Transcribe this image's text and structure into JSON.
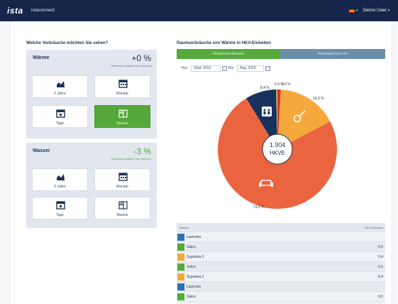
{
  "topbar": {
    "logo": "ista",
    "app_name": "istaconnect",
    "user": "Demo User",
    "user_caret": "▾",
    "language_caret": "▾"
  },
  "left": {
    "heading": "Welche Verbräuche möchten Sie sehen?",
    "warm": {
      "title": "Wärme",
      "value": "+0 %",
      "subtitle": "Verbrauchs-Vergleich zum Vormonat",
      "tiles": [
        {
          "label": "3 Jahre",
          "icon": "chart-icon"
        },
        {
          "label": "Monate",
          "icon": "calendar-month-icon"
        },
        {
          "label": "Tage",
          "icon": "calendar-day-icon"
        },
        {
          "label": "Räume",
          "icon": "rooms-icon",
          "active": true
        }
      ]
    },
    "water": {
      "title": "Wasser",
      "value": "-3 %",
      "subtitle": "Verbrauchs-Vergleich zum Vormonat",
      "tiles": [
        {
          "label": "3 Jahre",
          "icon": "chart-icon"
        },
        {
          "label": "Monate",
          "icon": "calendar-month-icon"
        },
        {
          "label": "Tage",
          "icon": "calendar-day-icon"
        },
        {
          "label": "Räume",
          "icon": "rooms-icon"
        }
      ]
    }
  },
  "right": {
    "heading": "Raumverbräuche von Wärme in HKV-Einheiten",
    "tabs": [
      "Gesamtverbrauch",
      "Verbrauch pro m²"
    ],
    "filter": {
      "from_label": "Von:",
      "from_value": "Sept. 2014",
      "to_label": "Bis:",
      "to_value": "Aug. 2016"
    },
    "center": {
      "value": "1.904",
      "unit": "HKVE"
    },
    "pie_labels": [
      "8,4 %",
      "0,3 %",
      "0,9 %",
      "16,3 %",
      "73,5 %"
    ],
    "table": {
      "headers": [
        "Räume",
        "HKV-Einheiten"
      ],
      "rows": [
        {
          "name": "Łazienka",
          "value": "",
          "color": "#2f6fb8"
        },
        {
          "name": "Salon",
          "value": "0,0",
          "color": "#56aa3b"
        },
        {
          "name": "Sypialnia 2",
          "value": "6,4",
          "color": "#f2a93b"
        },
        {
          "name": "Salon",
          "value": "0,0",
          "color": "#56aa3b"
        },
        {
          "name": "Sypialnia 2",
          "value": "6,4",
          "color": "#f2a93b"
        },
        {
          "name": "Łazienka",
          "value": "",
          "color": "#2f6fb8"
        },
        {
          "name": "Salon",
          "value": "0,0",
          "color": "#56aa3b"
        }
      ]
    }
  },
  "chart_data": {
    "type": "pie",
    "values": [
      73.5,
      16.3,
      0.9,
      0.3,
      8.4
    ],
    "colors": [
      "#ea6440",
      "#f5a93c",
      "#d8341f",
      "#f0c56a",
      "#17325c"
    ],
    "center_value": "1.904",
    "center_unit": "HKVE"
  }
}
